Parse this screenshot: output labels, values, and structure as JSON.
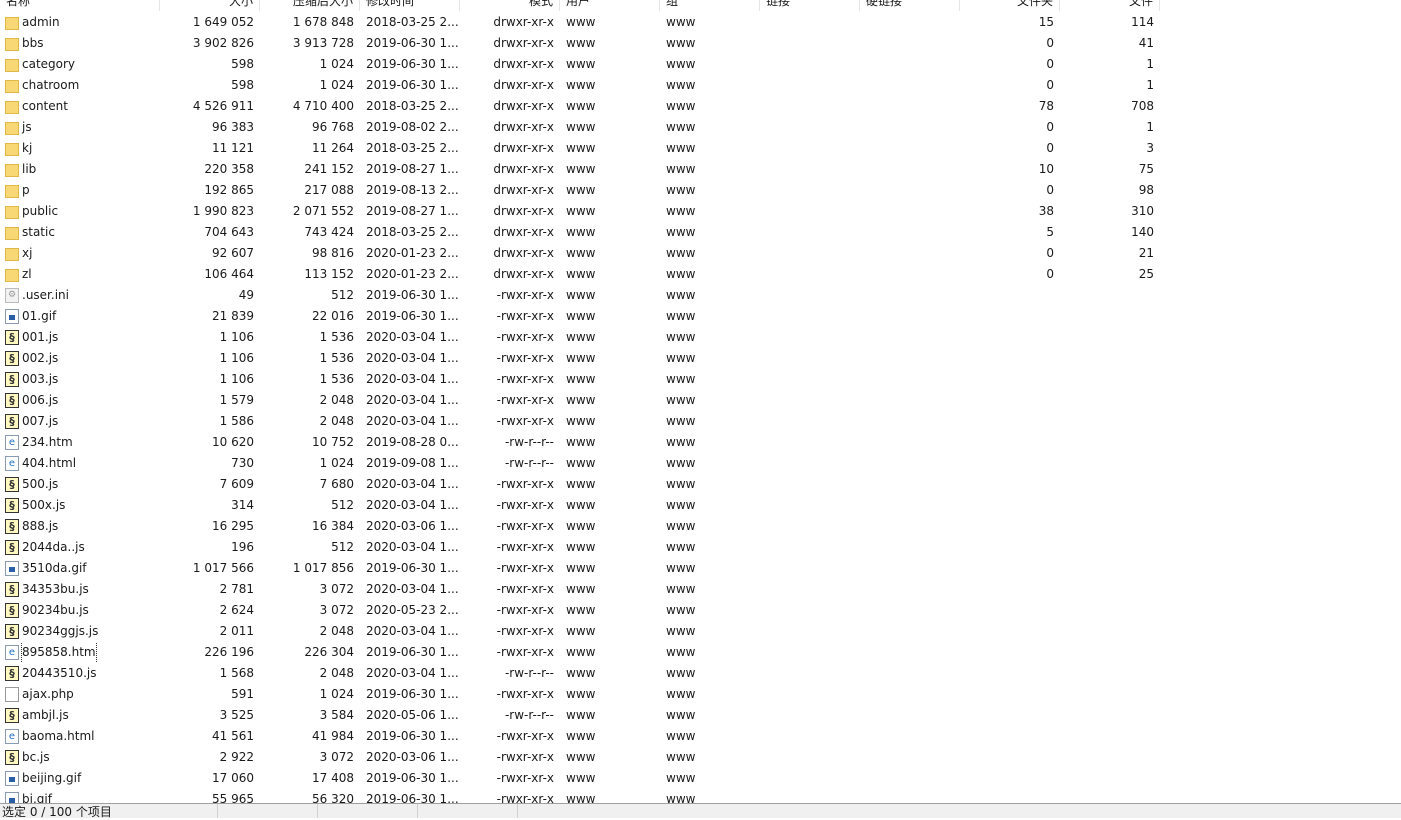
{
  "columns": [
    "名称",
    "大小",
    "压缩后大小",
    "修改时间",
    "模式",
    "用户",
    "组",
    "链接",
    "硬链接",
    "文件夹",
    "文件"
  ],
  "rows": [
    [
      "folder",
      "admin",
      "1 649 052",
      "1 678 848",
      "2018-03-25 2...",
      "drwxr-xr-x",
      "www",
      "www",
      "",
      "",
      "15",
      "114"
    ],
    [
      "folder",
      "bbs",
      "3 902 826",
      "3 913 728",
      "2019-06-30 1...",
      "drwxr-xr-x",
      "www",
      "www",
      "",
      "",
      "0",
      "41"
    ],
    [
      "folder",
      "category",
      "598",
      "1 024",
      "2019-06-30 1...",
      "drwxr-xr-x",
      "www",
      "www",
      "",
      "",
      "0",
      "1"
    ],
    [
      "folder",
      "chatroom",
      "598",
      "1 024",
      "2019-06-30 1...",
      "drwxr-xr-x",
      "www",
      "www",
      "",
      "",
      "0",
      "1"
    ],
    [
      "folder",
      "content",
      "4 526 911",
      "4 710 400",
      "2018-03-25 2...",
      "drwxr-xr-x",
      "www",
      "www",
      "",
      "",
      "78",
      "708"
    ],
    [
      "folder",
      "js",
      "96 383",
      "96 768",
      "2019-08-02 2...",
      "drwxr-xr-x",
      "www",
      "www",
      "",
      "",
      "0",
      "1"
    ],
    [
      "folder",
      "kj",
      "11 121",
      "11 264",
      "2018-03-25 2...",
      "drwxr-xr-x",
      "www",
      "www",
      "",
      "",
      "0",
      "3"
    ],
    [
      "folder",
      "lib",
      "220 358",
      "241 152",
      "2019-08-27 1...",
      "drwxr-xr-x",
      "www",
      "www",
      "",
      "",
      "10",
      "75"
    ],
    [
      "folder",
      "p",
      "192 865",
      "217 088",
      "2019-08-13 2...",
      "drwxr-xr-x",
      "www",
      "www",
      "",
      "",
      "0",
      "98"
    ],
    [
      "folder",
      "public",
      "1 990 823",
      "2 071 552",
      "2019-08-27 1...",
      "drwxr-xr-x",
      "www",
      "www",
      "",
      "",
      "38",
      "310"
    ],
    [
      "folder",
      "static",
      "704 643",
      "743 424",
      "2018-03-25 2...",
      "drwxr-xr-x",
      "www",
      "www",
      "",
      "",
      "5",
      "140"
    ],
    [
      "folder",
      "xj",
      "92 607",
      "98 816",
      "2020-01-23 2...",
      "drwxr-xr-x",
      "www",
      "www",
      "",
      "",
      "0",
      "21"
    ],
    [
      "folder",
      "zl",
      "106 464",
      "113 152",
      "2020-01-23 2...",
      "drwxr-xr-x",
      "www",
      "www",
      "",
      "",
      "0",
      "25"
    ],
    [
      "ini",
      ".user.ini",
      "49",
      "512",
      "2019-06-30 1...",
      "-rwxr-xr-x",
      "www",
      "www",
      "",
      "",
      "",
      ""
    ],
    [
      "gif",
      "01.gif",
      "21 839",
      "22 016",
      "2019-06-30 1...",
      "-rwxr-xr-x",
      "www",
      "www",
      "",
      "",
      "",
      ""
    ],
    [
      "js",
      "001.js",
      "1 106",
      "1 536",
      "2020-03-04 1...",
      "-rwxr-xr-x",
      "www",
      "www",
      "",
      "",
      "",
      ""
    ],
    [
      "js",
      "002.js",
      "1 106",
      "1 536",
      "2020-03-04 1...",
      "-rwxr-xr-x",
      "www",
      "www",
      "",
      "",
      "",
      ""
    ],
    [
      "js",
      "003.js",
      "1 106",
      "1 536",
      "2020-03-04 1...",
      "-rwxr-xr-x",
      "www",
      "www",
      "",
      "",
      "",
      ""
    ],
    [
      "js",
      "006.js",
      "1 579",
      "2 048",
      "2020-03-04 1...",
      "-rwxr-xr-x",
      "www",
      "www",
      "",
      "",
      "",
      ""
    ],
    [
      "js",
      "007.js",
      "1 586",
      "2 048",
      "2020-03-04 1...",
      "-rwxr-xr-x",
      "www",
      "www",
      "",
      "",
      "",
      ""
    ],
    [
      "htm",
      "234.htm",
      "10 620",
      "10 752",
      "2019-08-28 0...",
      "-rw-r--r--",
      "www",
      "www",
      "",
      "",
      "",
      ""
    ],
    [
      "htm",
      "404.html",
      "730",
      "1 024",
      "2019-09-08 1...",
      "-rw-r--r--",
      "www",
      "www",
      "",
      "",
      "",
      ""
    ],
    [
      "js",
      "500.js",
      "7 609",
      "7 680",
      "2020-03-04 1...",
      "-rwxr-xr-x",
      "www",
      "www",
      "",
      "",
      "",
      ""
    ],
    [
      "js",
      "500x.js",
      "314",
      "512",
      "2020-03-04 1...",
      "-rwxr-xr-x",
      "www",
      "www",
      "",
      "",
      "",
      ""
    ],
    [
      "js",
      "888.js",
      "16 295",
      "16 384",
      "2020-03-06 1...",
      "-rwxr-xr-x",
      "www",
      "www",
      "",
      "",
      "",
      ""
    ],
    [
      "js",
      "2044da..js",
      "196",
      "512",
      "2020-03-04 1...",
      "-rwxr-xr-x",
      "www",
      "www",
      "",
      "",
      "",
      ""
    ],
    [
      "gif",
      "3510da.gif",
      "1 017 566",
      "1 017 856",
      "2019-06-30 1...",
      "-rwxr-xr-x",
      "www",
      "www",
      "",
      "",
      "",
      ""
    ],
    [
      "js",
      "34353bu.js",
      "2 781",
      "3 072",
      "2020-03-04 1...",
      "-rwxr-xr-x",
      "www",
      "www",
      "",
      "",
      "",
      ""
    ],
    [
      "js",
      "90234bu.js",
      "2 624",
      "3 072",
      "2020-05-23 2...",
      "-rwxr-xr-x",
      "www",
      "www",
      "",
      "",
      "",
      ""
    ],
    [
      "js",
      "90234ggjs.js",
      "2 011",
      "2 048",
      "2020-03-04 1...",
      "-rwxr-xr-x",
      "www",
      "www",
      "",
      "",
      "",
      ""
    ],
    [
      "htm",
      "895858.htm",
      "226 196",
      "226 304",
      "2019-06-30 1...",
      "-rwxr-xr-x",
      "www",
      "www",
      "",
      "",
      "",
      ""
    ],
    [
      "js",
      "20443510.js",
      "1 568",
      "2 048",
      "2020-03-04 1...",
      "-rw-r--r--",
      "www",
      "www",
      "",
      "",
      "",
      ""
    ],
    [
      "php",
      "ajax.php",
      "591",
      "1 024",
      "2019-06-30 1...",
      "-rwxr-xr-x",
      "www",
      "www",
      "",
      "",
      "",
      ""
    ],
    [
      "js",
      "ambjl.js",
      "3 525",
      "3 584",
      "2020-05-06 1...",
      "-rw-r--r--",
      "www",
      "www",
      "",
      "",
      "",
      ""
    ],
    [
      "htm",
      "baoma.html",
      "41 561",
      "41 984",
      "2019-06-30 1...",
      "-rwxr-xr-x",
      "www",
      "www",
      "",
      "",
      "",
      ""
    ],
    [
      "js",
      "bc.js",
      "2 922",
      "3 072",
      "2020-03-06 1...",
      "-rwxr-xr-x",
      "www",
      "www",
      "",
      "",
      "",
      ""
    ],
    [
      "gif",
      "beijing.gif",
      "17 060",
      "17 408",
      "2019-06-30 1...",
      "-rwxr-xr-x",
      "www",
      "www",
      "",
      "",
      "",
      ""
    ],
    [
      "gif",
      "bj.gif",
      "55 965",
      "56 320",
      "2019-06-30 1...",
      "-rwxr-xr-x",
      "www",
      "www",
      "",
      "",
      "",
      ""
    ]
  ],
  "focused_item": "895858.htm",
  "status": {
    "selection": "选定 0 / 100 个项目"
  }
}
